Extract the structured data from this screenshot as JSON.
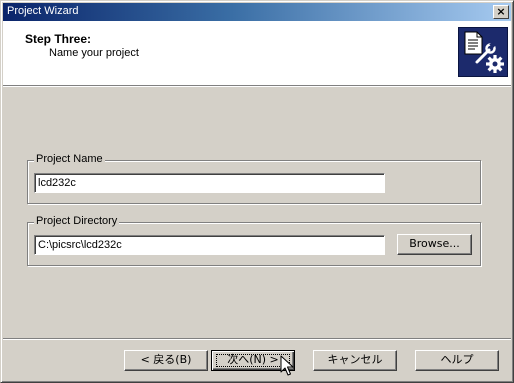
{
  "window": {
    "title": "Project Wizard",
    "close_icon": "×"
  },
  "header": {
    "step_title": "Step Three:",
    "step_subtitle": "Name your project",
    "icon": "project-wizard-icon"
  },
  "project_name": {
    "label": "Project Name",
    "value": "lcd232c"
  },
  "project_directory": {
    "label": "Project Directory",
    "value": "C:\\picsrc\\lcd232c",
    "browse_label": "Browse..."
  },
  "footer": {
    "back_label": "< 戻る(B)",
    "next_label": "次へ(N) >",
    "cancel_label": "キャンセル",
    "help_label": "ヘルプ"
  },
  "colors": {
    "face": "#d4d0c8",
    "title_start": "#0a246a",
    "title_end": "#a6caf0",
    "icon_bg": "#1c2a6c"
  }
}
